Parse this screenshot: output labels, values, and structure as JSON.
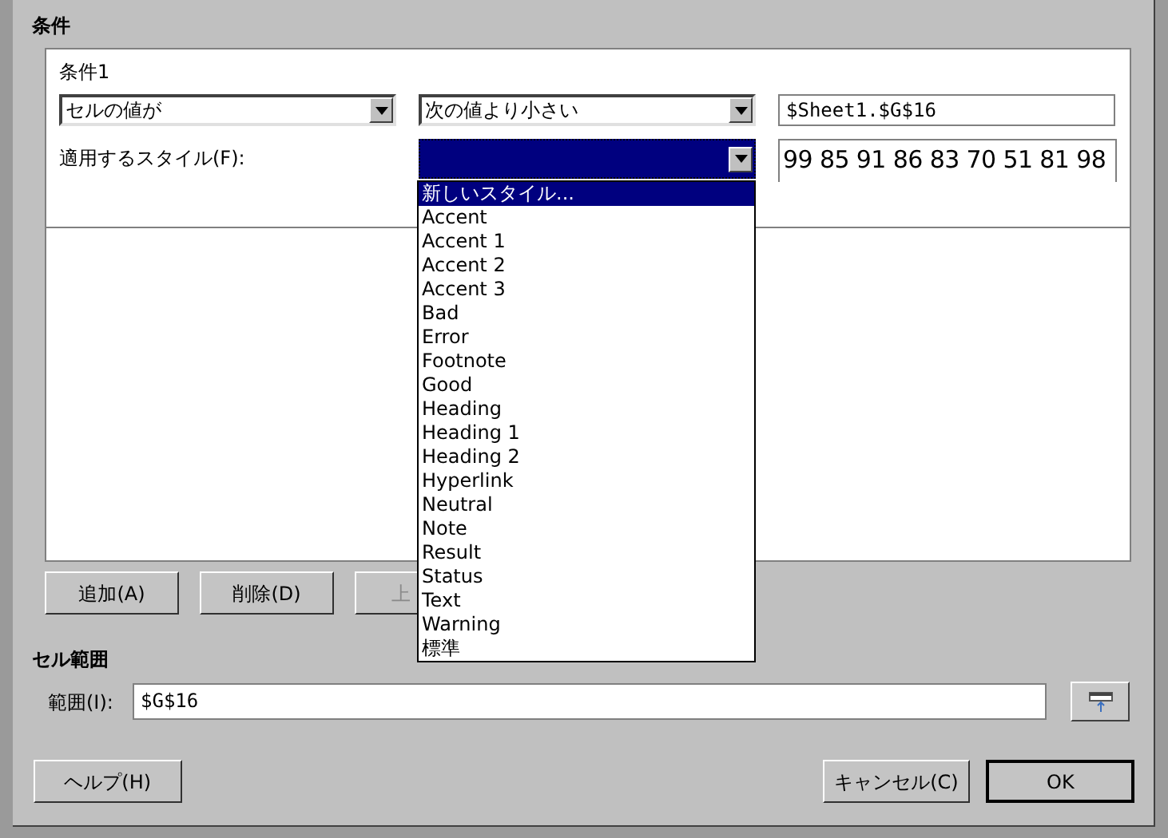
{
  "dialog": {
    "title": "条件"
  },
  "condition": {
    "heading": "条件1",
    "type_select": {
      "value": "セルの値が"
    },
    "operator_select": {
      "value": "次の値より小さい"
    },
    "value_field": {
      "value": "$Sheet1.$G$16"
    },
    "style_label": "適用するスタイル(F):",
    "style_select": {
      "expanded": true
    },
    "preview": "99 85 91 86 83 70 51 81 98",
    "style_options": [
      {
        "label": "新しいスタイル...",
        "selected": true
      },
      {
        "label": "Accent",
        "selected": false
      },
      {
        "label": "Accent 1",
        "selected": false
      },
      {
        "label": "Accent 2",
        "selected": false
      },
      {
        "label": "Accent 3",
        "selected": false
      },
      {
        "label": "Bad",
        "selected": false
      },
      {
        "label": "Error",
        "selected": false
      },
      {
        "label": "Footnote",
        "selected": false
      },
      {
        "label": "Good",
        "selected": false
      },
      {
        "label": "Heading",
        "selected": false
      },
      {
        "label": "Heading 1",
        "selected": false
      },
      {
        "label": "Heading 2",
        "selected": false
      },
      {
        "label": "Hyperlink",
        "selected": false
      },
      {
        "label": "Neutral",
        "selected": false
      },
      {
        "label": "Note",
        "selected": false
      },
      {
        "label": "Result",
        "selected": false
      },
      {
        "label": "Status",
        "selected": false
      },
      {
        "label": "Text",
        "selected": false
      },
      {
        "label": "Warning",
        "selected": false
      },
      {
        "label": "標準",
        "selected": false
      }
    ]
  },
  "condition_buttons": [
    {
      "label": "追加(A)",
      "disabled": false
    },
    {
      "label": "削除(D)",
      "disabled": false
    },
    {
      "label": "上",
      "disabled": true
    }
  ],
  "cell_range": {
    "heading": "セル範囲",
    "label": "範囲(I):",
    "value": "$G$16"
  },
  "footer_buttons": [
    {
      "label": "ヘルプ(H)",
      "default": false
    },
    {
      "label": "キャンセル(C)",
      "default": false
    },
    {
      "label": "OK",
      "default": true
    }
  ]
}
